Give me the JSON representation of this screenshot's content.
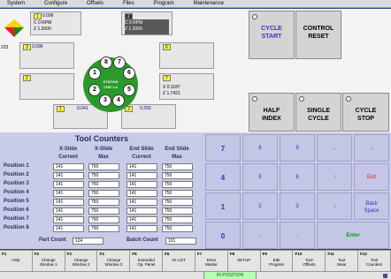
{
  "menu": [
    "System",
    "Configure",
    "Offsets",
    "Files",
    "Program",
    "Maintenance"
  ],
  "code": "223",
  "axes": {
    "top_left": {
      "tag": "1",
      "value": "0.096",
      "lines": "C 0 RPM\nZ 1.2000"
    },
    "top_right": {
      "tag": "2",
      "lines": "C 0 RPM\nZ 1.2000"
    },
    "mid_left": {
      "tag": "3",
      "value": "3.096"
    },
    "mid_right": {
      "tag": "6",
      "value": ""
    },
    "low_left": {
      "tag": "2",
      "value": ""
    },
    "low_right": {
      "tag": "7",
      "lines": "X 0.1187\nZ 1.7421"
    },
    "bottom_left": {
      "tag": "1",
      "value": "0.041"
    },
    "bottom_right": {
      "tag": "3",
      "value": "0.250"
    }
  },
  "turret": {
    "tools": [
      "8",
      "7",
      "1",
      "6",
      "2",
      "5",
      "3",
      "4"
    ],
    "hub": "STATION\nCHG 1-2"
  },
  "panel": {
    "cycle_start": "CYCLE\nSTART",
    "control_reset": "CONTROL\nRESET",
    "half_index": "HALF\nINDEX",
    "single_cycle": "SINGLE\nCYCLE",
    "cycle_stop": "CYCLE\nSTOP"
  },
  "counters": {
    "title": "Tool Counters",
    "columns": [
      "X-Slide\nCurrent",
      "X-Slide\nMax",
      "End Slide\nCurrent",
      "End Slide\nMax"
    ],
    "rows": [
      {
        "label": "Position 1",
        "values": [
          "141",
          "750",
          "141",
          "750"
        ]
      },
      {
        "label": "Position 2",
        "values": [
          "141",
          "750",
          "141",
          "750"
        ]
      },
      {
        "label": "Position 3",
        "values": [
          "141",
          "750",
          "141",
          "750"
        ]
      },
      {
        "label": "Position 4",
        "values": [
          "141",
          "750",
          "141",
          "750"
        ]
      },
      {
        "label": "Position 5",
        "values": [
          "141",
          "750",
          "141",
          "750"
        ]
      },
      {
        "label": "Position 6",
        "values": [
          "141",
          "750",
          "141",
          "750"
        ]
      },
      {
        "label": "Position 7",
        "values": [
          "141",
          "750",
          "141",
          "750"
        ]
      },
      {
        "label": "Position 8",
        "values": [
          "141",
          "750",
          "141",
          "750"
        ]
      }
    ],
    "part_count_label": "Part Count",
    "part_count": "124",
    "batch_count_label": "Batch Count",
    "batch_count": "101"
  },
  "keypad": {
    "r1": [
      "7",
      "8",
      "9",
      "←",
      "→"
    ],
    "r2": [
      "4",
      "5",
      "6",
      "↑",
      "Exit"
    ],
    "r3": [
      "1",
      "2",
      "3",
      "↓",
      "Back\nSpace"
    ],
    "r4": [
      "0",
      "-",
      ".",
      "Enter"
    ]
  },
  "fkeys": [
    {
      "num": "F1",
      "label": "Help"
    },
    {
      "num": "F2",
      "label": "Change\nWindow 1"
    },
    {
      "num": "F3",
      "label": "Change\nWindow 2"
    },
    {
      "num": "F4",
      "label": "Change\nWindow 3"
    },
    {
      "num": "F5",
      "label": "Extended\nOp. Panel"
    },
    {
      "num": "F6",
      "label": "IO LIST"
    },
    {
      "num": "F7",
      "label": "Drive\nMaster"
    },
    {
      "num": "F8",
      "label": "SETUP"
    },
    {
      "num": "F9",
      "label": "Edit\nProgram"
    },
    {
      "num": "F10",
      "label": "Tool\nOffsets"
    },
    {
      "num": "F11",
      "label": "Tool\nWear"
    },
    {
      "num": "F12",
      "label": "Tool\nCounters"
    }
  ],
  "status": "IN POSITION",
  "colors": {
    "accent_green": "#2a9a2a",
    "blue_text": "#3333cc",
    "exit_red": "#e02020",
    "panel_bg": "#c8cce8"
  }
}
